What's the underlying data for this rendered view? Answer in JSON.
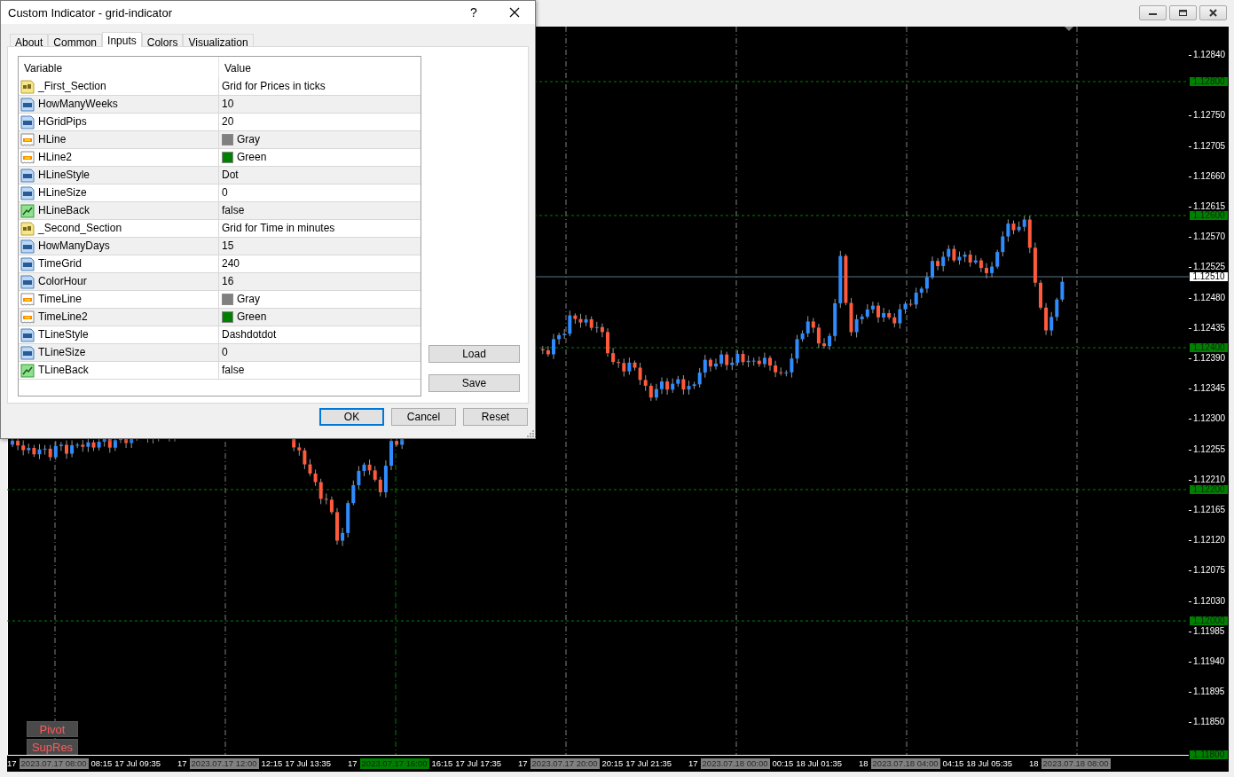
{
  "dialog": {
    "title": "Custom Indicator - grid-indicator",
    "help": "?",
    "tabs": [
      {
        "label": "About",
        "selected": false
      },
      {
        "label": "Common",
        "selected": false
      },
      {
        "label": "Inputs",
        "selected": true
      },
      {
        "label": "Colors",
        "selected": false
      },
      {
        "label": "Visualization",
        "selected": false
      }
    ],
    "table": {
      "columns": [
        "Variable",
        "Value"
      ],
      "rows": [
        {
          "kind": "string",
          "name": "_First_Section",
          "value": "Grid for Prices in ticks"
        },
        {
          "kind": "int",
          "name": "HowManyWeeks",
          "value": "10"
        },
        {
          "kind": "int",
          "name": "HGridPips",
          "value": "20"
        },
        {
          "kind": "color",
          "name": "HLine",
          "value": "Gray",
          "color": "#808080"
        },
        {
          "kind": "color",
          "name": "HLine2",
          "value": "Green",
          "color": "#008000"
        },
        {
          "kind": "int",
          "name": "HLineStyle",
          "value": "Dot"
        },
        {
          "kind": "int",
          "name": "HLineSize",
          "value": "0"
        },
        {
          "kind": "bool",
          "name": "HLineBack",
          "value": "false"
        },
        {
          "kind": "string",
          "name": "_Second_Section",
          "value": "Grid for Time in minutes"
        },
        {
          "kind": "int",
          "name": "HowManyDays",
          "value": "15"
        },
        {
          "kind": "int",
          "name": "TimeGrid",
          "value": "240"
        },
        {
          "kind": "int",
          "name": "ColorHour",
          "value": "16"
        },
        {
          "kind": "color",
          "name": "TimeLine",
          "value": "Gray",
          "color": "#808080"
        },
        {
          "kind": "color",
          "name": "TimeLine2",
          "value": "Green",
          "color": "#008000"
        },
        {
          "kind": "int",
          "name": "TLineStyle",
          "value": "Dashdotdot"
        },
        {
          "kind": "int",
          "name": "TLineSize",
          "value": "0"
        },
        {
          "kind": "bool",
          "name": "TLineBack",
          "value": "false"
        }
      ]
    },
    "side_buttons": [
      "Load",
      "Save"
    ],
    "buttons": [
      {
        "label": "OK",
        "default": true
      },
      {
        "label": "Cancel",
        "default": false
      },
      {
        "label": "Reset",
        "default": false
      }
    ]
  },
  "chart": {
    "buttons": [
      "Pivot",
      "SupRes"
    ],
    "price_axis": {
      "labels": [
        "1.12840",
        "1.12750",
        "1.12705",
        "1.12660",
        "1.12615",
        "1.12570",
        "1.12525",
        "1.12480",
        "1.12435",
        "1.12390",
        "1.12345",
        "1.12300",
        "1.12255",
        "1.12210",
        "1.12165",
        "1.12120",
        "1.12075",
        "1.12030",
        "1.11985",
        "1.11940",
        "1.11895",
        "1.11850"
      ],
      "markers": [
        {
          "text": "1.12800",
          "color": "#008000"
        },
        {
          "text": "1.12600",
          "color": "#008000"
        },
        {
          "text": "1.12510",
          "color": "#ffffff"
        },
        {
          "text": "1.12400",
          "color": "#008000"
        },
        {
          "text": "1.12200",
          "color": "#008000"
        },
        {
          "text": "1.12000",
          "color": "#008000"
        },
        {
          "text": "1.11800",
          "color": "#008000"
        }
      ]
    },
    "time_axis": [
      {
        "stub": "17",
        "marker": "2023.07.17 08:00",
        "color": "#808080",
        "tail": "08:15",
        "label": "17 Jul 09:35"
      },
      {
        "stub": "17",
        "marker": "2023.07.17 12:00",
        "color": "#808080",
        "tail": "12:15",
        "label": "17 Jul 13:35"
      },
      {
        "stub": "17",
        "marker": "2023.07.17 16:00",
        "color": "#008000",
        "tail": "16:15",
        "label": "17 Jul 17:35"
      },
      {
        "stub": "17",
        "marker": "2023.07.17 20:00",
        "color": "#808080",
        "tail": "20:15",
        "label": "17 Jul 21:35"
      },
      {
        "stub": "17",
        "marker": "2023.07.18 00:00",
        "color": "#808080",
        "tail": "00:15",
        "label": "18 Jul 01:35"
      },
      {
        "stub": "18",
        "marker": "2023.07.18 04:00",
        "color": "#808080",
        "tail": "04:15",
        "label": "18 Jul 05:35"
      },
      {
        "stub": "18",
        "marker": "2023.07.18 08:00",
        "color": "#808080"
      }
    ]
  }
}
